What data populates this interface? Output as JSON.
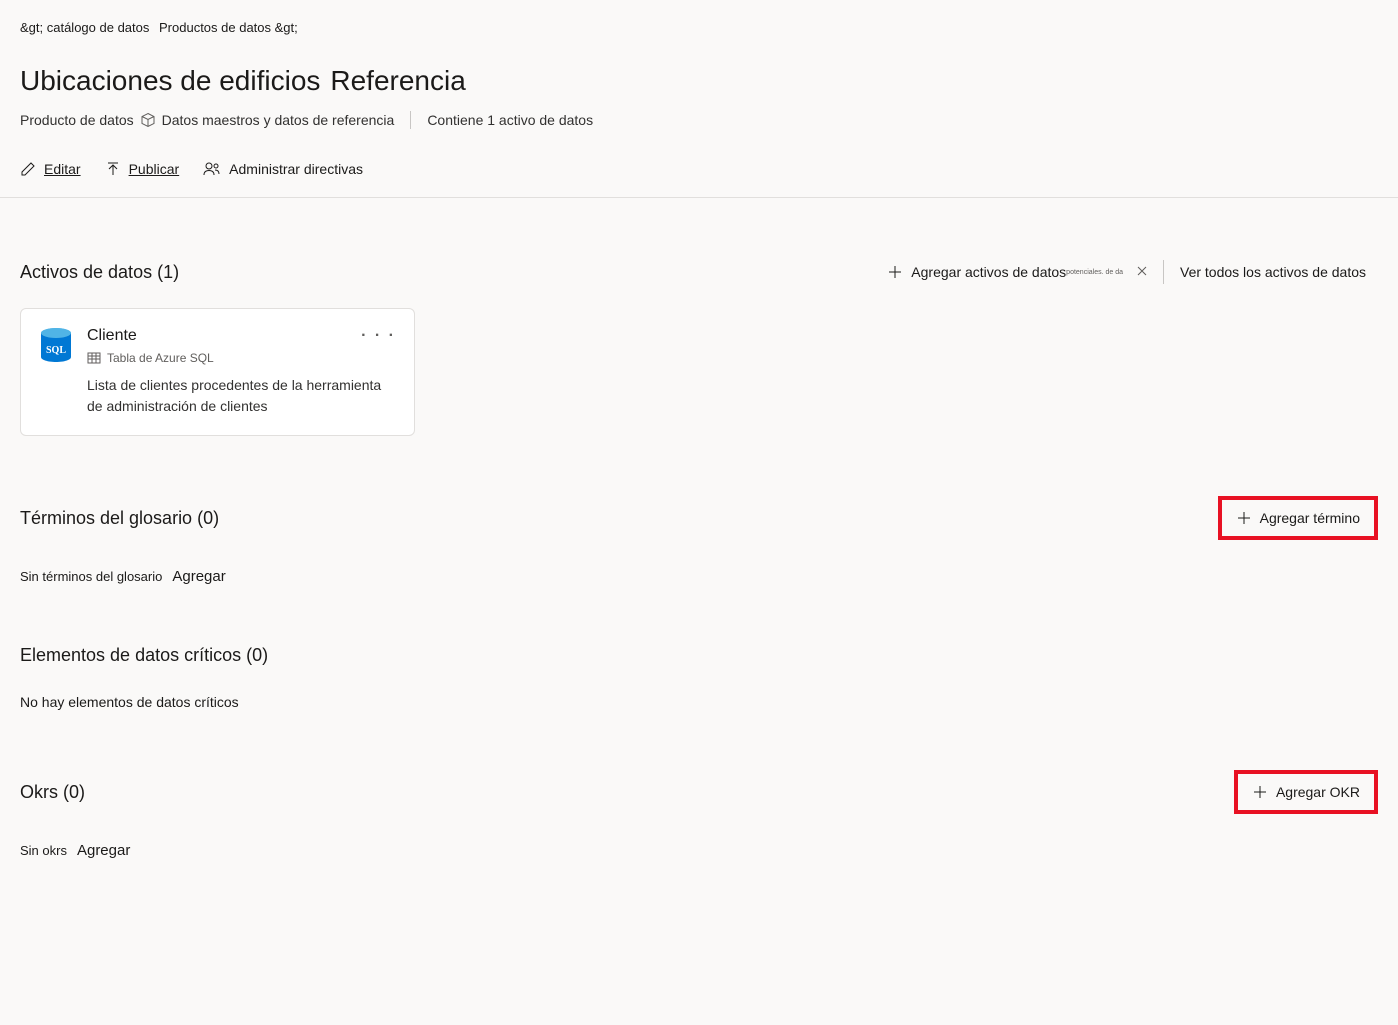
{
  "breadcrumb": {
    "part1": "&gt; catálogo de datos",
    "part2": "Productos de datos &gt;"
  },
  "title": {
    "main": "Ubicaciones de edificios",
    "tag": "Referencia"
  },
  "meta": {
    "product_label": "Producto de datos",
    "type_label": "Datos maestros y datos de referencia",
    "contains_label": "Contiene 1 activo de datos"
  },
  "toolbar": {
    "edit": "Editar",
    "publish": "Publicar",
    "policies": "Administrar directivas"
  },
  "assets": {
    "title": "Activos de datos (1)",
    "add_label": "Agregar activos de datos",
    "add_sublabel": "potenciales. de da",
    "view_all_label": "Ver todos los activos de datos",
    "card": {
      "name": "Cliente",
      "subtype": "Tabla de Azure SQL",
      "description": "Lista de clientes procedentes de la herramienta de administración de clientes"
    }
  },
  "glossary": {
    "title": "Términos del glosario (0)",
    "add_button": "Agregar término",
    "empty_text": "Sin términos del glosario",
    "add_link": "Agregar"
  },
  "critical": {
    "title": "Elementos de datos críticos (0)",
    "empty_text": "No hay elementos de datos críticos"
  },
  "okrs": {
    "title": "Okrs (0)",
    "add_button": "Agregar OKR",
    "empty_text": "Sin okrs",
    "add_link": "Agregar"
  }
}
